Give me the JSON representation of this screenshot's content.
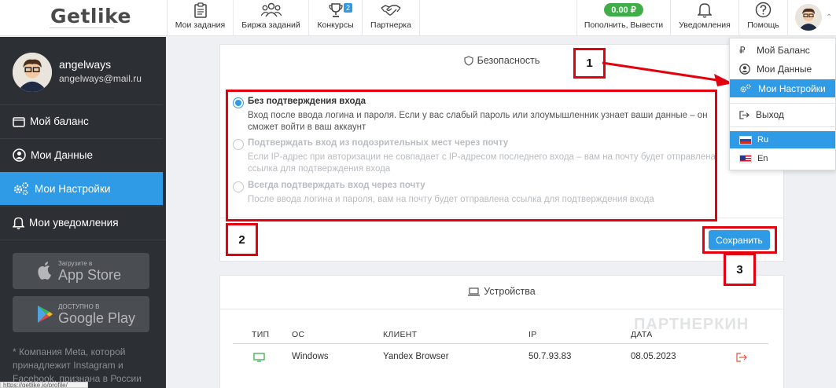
{
  "app": {
    "logo": "Getlike"
  },
  "nav": {
    "tasks": "Мои задания",
    "exchange": "Биржа заданий",
    "contests": "Конкурсы",
    "contests_badge": "2",
    "partner": "Партнерка",
    "balance": "0.00 ₽",
    "topup": "Пополнить, Вывести",
    "notifications": "Уведомления",
    "help": "Помощь"
  },
  "user": {
    "name": "angelways",
    "email": "angelways@mail.ru"
  },
  "sidebar": {
    "items": [
      {
        "label": "Мой баланс",
        "icon": "wallet-icon"
      },
      {
        "label": "Мои Данные",
        "icon": "user-circle-icon"
      },
      {
        "label": "Мои Настройки",
        "icon": "cogs-icon",
        "active": true
      },
      {
        "label": "Мои уведомления",
        "icon": "bell-icon"
      }
    ],
    "appstore_small": "Загрузите в",
    "appstore_big": "App Store",
    "googleplay_small": "ДОСТУПНО В",
    "googleplay_big": "Google Play",
    "footer": "* Компания Meta, которой принадлежит Instagram и Facebook, признана в России"
  },
  "security": {
    "title": "Безопасность",
    "options": [
      {
        "title": "Без подтверждения входа",
        "desc": "Вход после ввода логина и пароля. Если у вас слабый пароль или злоумышленник узнает ваши данные – он сможет войти в ваш аккаунт",
        "selected": true
      },
      {
        "title": "Подтверждать вход из подозрительных мест через почту",
        "desc": "Если IP-адрес при авторизации не совпадает с IP-адресом последнего входа – вам на почту будет отправлена ссылка для подтверждения входа",
        "selected": false
      },
      {
        "title": "Всегда подтверждать вход через почту",
        "desc": "После ввода логина и пароля, вам на почту будет отправлена ссылка для подтверждения входа",
        "selected": false
      }
    ],
    "save": "Сохранить"
  },
  "devices": {
    "title": "Устройства",
    "headers": {
      "type": "ТИП",
      "os": "ОС",
      "client": "КЛИЕНТ",
      "ip": "IP",
      "date": "ДАТА"
    },
    "rows": [
      {
        "os": "Windows",
        "client": "Yandex Browser",
        "ip": "50.7.93.83",
        "date": "08.05.2023"
      }
    ]
  },
  "dropdown": {
    "balance": "Мой Баланс",
    "data": "Мои Данные",
    "settings": "Мои Настройки",
    "logout": "Выход",
    "lang_ru": "Ru",
    "lang_en": "En"
  },
  "annotations": {
    "one": "1",
    "two": "2",
    "three": "3"
  },
  "status_url": "https://getlike.io/profile/",
  "watermark": "ПАРТНЕРКИН",
  "colors": {
    "accent": "#2f9be6",
    "success": "#3fae49",
    "annotation": "#e3000f",
    "sidebar": "#2c2f33"
  }
}
